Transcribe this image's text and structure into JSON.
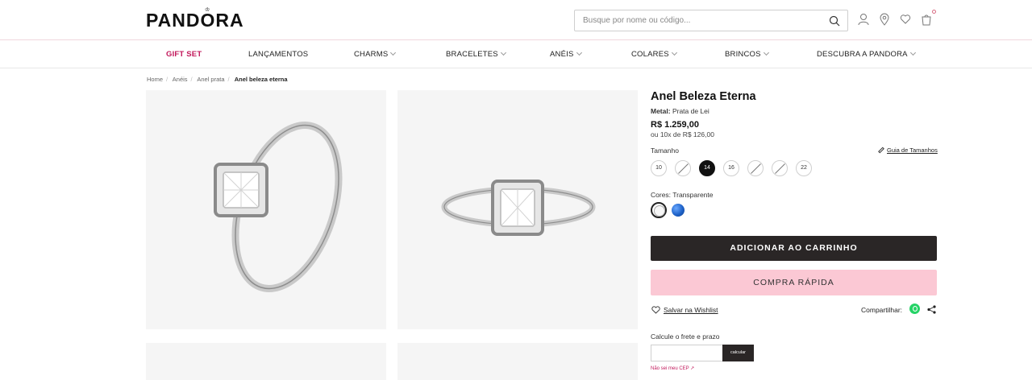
{
  "header": {
    "logo": "PANDORA",
    "search_placeholder": "Busque por nome ou código...",
    "icons": [
      "search-icon",
      "user-icon",
      "location-icon",
      "heart-icon",
      "bag-icon"
    ]
  },
  "nav": {
    "items": [
      {
        "label": "GIFT SET",
        "dropdown": false
      },
      {
        "label": "LANÇAMENTOS",
        "dropdown": false
      },
      {
        "label": "CHARMS",
        "dropdown": true
      },
      {
        "label": "BRACELETES",
        "dropdown": true
      },
      {
        "label": "ANÉIS",
        "dropdown": true
      },
      {
        "label": "COLARES",
        "dropdown": true
      },
      {
        "label": "BRINCOS",
        "dropdown": true
      },
      {
        "label": "DESCUBRA A PANDORA",
        "dropdown": true
      }
    ]
  },
  "breadcrumb": [
    "Home",
    "Anéis",
    "Anel prata",
    "Anel beleza eterna"
  ],
  "product": {
    "title": "Anel Beleza Eterna",
    "metal_label": "Metal:",
    "metal_value": "Prata de Lei",
    "price": "R$ 1.259,00",
    "installments": "ou 10x de R$ 126,00",
    "size_label": "Tamanho",
    "size_guide": "Guia de Tamanhos",
    "sizes": [
      {
        "value": "10",
        "state": "available"
      },
      {
        "value": "12",
        "state": "disabled"
      },
      {
        "value": "14",
        "state": "selected"
      },
      {
        "value": "16",
        "state": "available"
      },
      {
        "value": "18",
        "state": "disabled"
      },
      {
        "value": "20",
        "state": "disabled"
      },
      {
        "value": "22",
        "state": "available"
      }
    ],
    "color_label": "Cores: Transparente",
    "colors": [
      {
        "name": "Transparente",
        "hex": "#f7f7f7",
        "selected": true
      },
      {
        "name": "Azul",
        "hex": "#1f63c9",
        "selected": false
      }
    ],
    "add_to_cart": "ADICIONAR AO CARRINHO",
    "quick_buy": "COMPRA RÁPIDA",
    "wishlist": "Salvar na Wishlist",
    "share_label": "Compartilhar:",
    "shipping_label": "Calcule o frete e prazo",
    "calc_button": "calcular",
    "dont_know_cep": "Não sei meu CEP"
  },
  "colors": {
    "accent_pink": "#fbc8d4",
    "gift_red": "#c2185b",
    "dark_button": "#2a2626"
  }
}
